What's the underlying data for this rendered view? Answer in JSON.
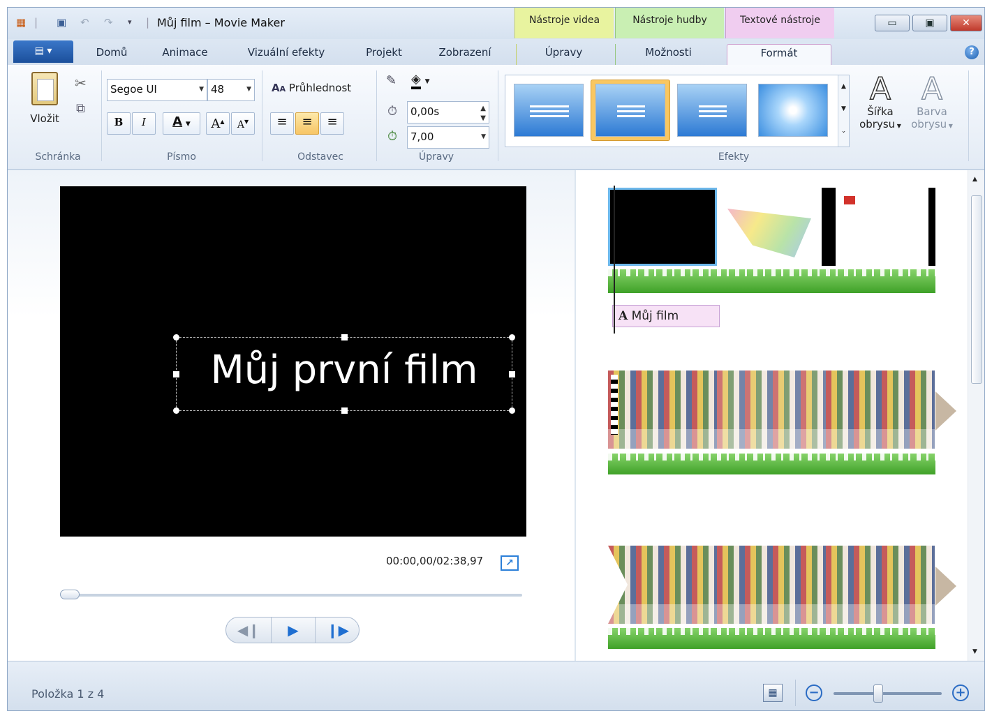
{
  "window": {
    "title": "Můj film – Movie Maker"
  },
  "quick_access": {
    "icons": [
      "app-icon",
      "save-icon",
      "undo-icon",
      "redo-icon",
      "customize-icon"
    ]
  },
  "context_groups": [
    {
      "label": "Nástroje videa",
      "color": "#e8f39f"
    },
    {
      "label": "Nástroje hudby",
      "color": "#c9efb3"
    },
    {
      "label": "Textové nástroje",
      "color": "#f0cdf0"
    }
  ],
  "tabs": {
    "home": "Domů",
    "animations": "Animace",
    "visual_effects": "Vizuální efekty",
    "project": "Projekt",
    "view": "Zobrazení",
    "edit": "Úpravy",
    "options": "Možnosti",
    "format": "Formát"
  },
  "ribbon": {
    "clipboard": {
      "paste_label": "Vložit",
      "group": "Schránka"
    },
    "font": {
      "family": "Segoe UI",
      "size": "48",
      "bold": "B",
      "italic": "I",
      "color_glyph": "A",
      "grow": "A",
      "shrink": "A",
      "group": "Písmo"
    },
    "paragraph": {
      "transparency_label": "Průhlednost",
      "group": "Odstavec"
    },
    "adjust": {
      "start_time": "0,00s",
      "duration": "7,00",
      "group": "Úpravy"
    },
    "effects": {
      "group": "Efekty",
      "selected_index": 1
    },
    "outline_width": {
      "line1": "Šířka",
      "line2": "obrysu"
    },
    "outline_color": {
      "line1": "Barva",
      "line2": "obrysu"
    }
  },
  "preview": {
    "text": "Můj první film",
    "timecode": "00:00,00/02:38,97"
  },
  "storyboard": {
    "caption": "Můj film"
  },
  "status": {
    "item_text": "Položka 1 z 4"
  },
  "colors": {
    "accent": "#2b7fd8",
    "selection": "#f9c761",
    "caption_bg": "#f7e2f6",
    "audio_wave": "#4fae32"
  }
}
